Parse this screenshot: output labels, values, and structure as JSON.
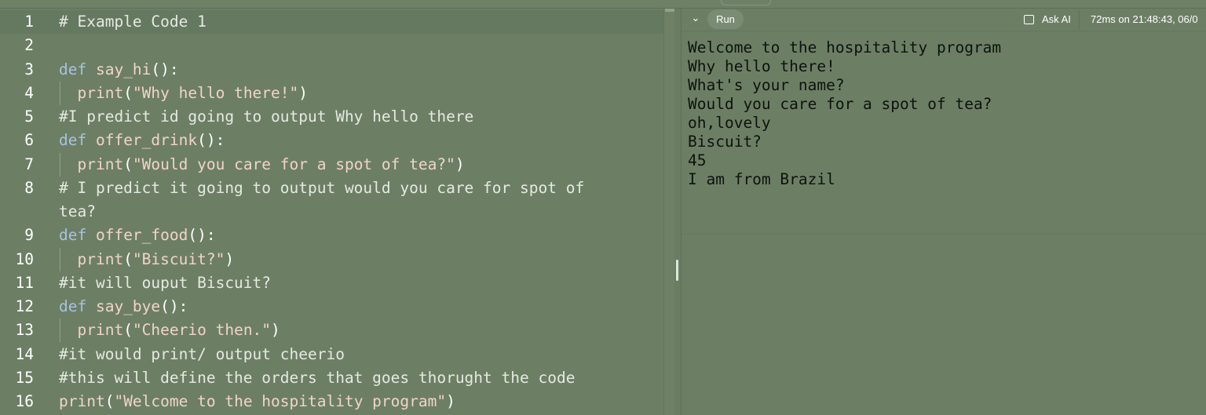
{
  "editor": {
    "lines": [
      {
        "num": "1",
        "parts": [
          {
            "t": "comment",
            "v": "# Example Code 1"
          }
        ]
      },
      {
        "num": "2",
        "parts": []
      },
      {
        "num": "3",
        "parts": [
          {
            "t": "kw",
            "v": "def"
          },
          {
            "t": "fn",
            "v": " say_hi"
          },
          {
            "t": "punc",
            "v": "():"
          }
        ]
      },
      {
        "num": "4",
        "indent": true,
        "parts": [
          {
            "t": "fn",
            "v": "  print"
          },
          {
            "t": "punc",
            "v": "("
          },
          {
            "t": "str",
            "v": "\"Why hello there!\""
          },
          {
            "t": "punc",
            "v": ")"
          }
        ]
      },
      {
        "num": "5",
        "parts": [
          {
            "t": "comment",
            "v": "#I predict id going to output Why hello there"
          }
        ]
      },
      {
        "num": "6",
        "parts": [
          {
            "t": "kw",
            "v": "def"
          },
          {
            "t": "fn",
            "v": " offer_drink"
          },
          {
            "t": "punc",
            "v": "():"
          }
        ]
      },
      {
        "num": "7",
        "indent": true,
        "parts": [
          {
            "t": "fn",
            "v": "  print"
          },
          {
            "t": "punc",
            "v": "("
          },
          {
            "t": "str",
            "v": "\"Would you care for a spot of tea?\""
          },
          {
            "t": "punc",
            "v": ")"
          }
        ]
      },
      {
        "num": "8",
        "parts": [
          {
            "t": "comment",
            "v": "# I predict it going to output would you care for spot of"
          }
        ]
      },
      {
        "num": "",
        "parts": [
          {
            "t": "comment",
            "v": "tea?"
          }
        ]
      },
      {
        "num": "9",
        "parts": [
          {
            "t": "kw",
            "v": "def"
          },
          {
            "t": "fn",
            "v": " offer_food"
          },
          {
            "t": "punc",
            "v": "():"
          }
        ]
      },
      {
        "num": "10",
        "indent": true,
        "parts": [
          {
            "t": "fn",
            "v": "  print"
          },
          {
            "t": "punc",
            "v": "("
          },
          {
            "t": "str",
            "v": "\"Biscuit?\""
          },
          {
            "t": "punc",
            "v": ")"
          }
        ]
      },
      {
        "num": "11",
        "parts": [
          {
            "t": "comment",
            "v": "#it will ouput Biscuit?"
          }
        ]
      },
      {
        "num": "12",
        "parts": [
          {
            "t": "kw",
            "v": "def"
          },
          {
            "t": "fn",
            "v": " say_bye"
          },
          {
            "t": "punc",
            "v": "():"
          }
        ]
      },
      {
        "num": "13",
        "indent": true,
        "parts": [
          {
            "t": "fn",
            "v": "  print"
          },
          {
            "t": "punc",
            "v": "("
          },
          {
            "t": "str",
            "v": "\"Cheerio then.\""
          },
          {
            "t": "punc",
            "v": ")"
          }
        ]
      },
      {
        "num": "14",
        "parts": [
          {
            "t": "comment",
            "v": "#it would print/ output cheerio"
          }
        ]
      },
      {
        "num": "15",
        "parts": [
          {
            "t": "comment",
            "v": "#this will define the orders that goes thorught the code"
          }
        ]
      },
      {
        "num": "16",
        "parts": [
          {
            "t": "fn",
            "v": "print"
          },
          {
            "t": "punc",
            "v": "("
          },
          {
            "t": "str",
            "v": "\"Welcome to the hospitality program\""
          },
          {
            "t": "punc",
            "v": ")"
          }
        ]
      }
    ]
  },
  "console": {
    "run_label": "Run",
    "ask_ai_label": "Ask AI",
    "timing": "72ms on 21:48:43, 06/0",
    "output": [
      "Welcome to the hospitality program",
      "Why hello there!",
      "What's your name?",
      "Would you care for a spot of tea?",
      "oh,lovely",
      "Biscuit?",
      "45",
      "I am from Brazil"
    ]
  }
}
